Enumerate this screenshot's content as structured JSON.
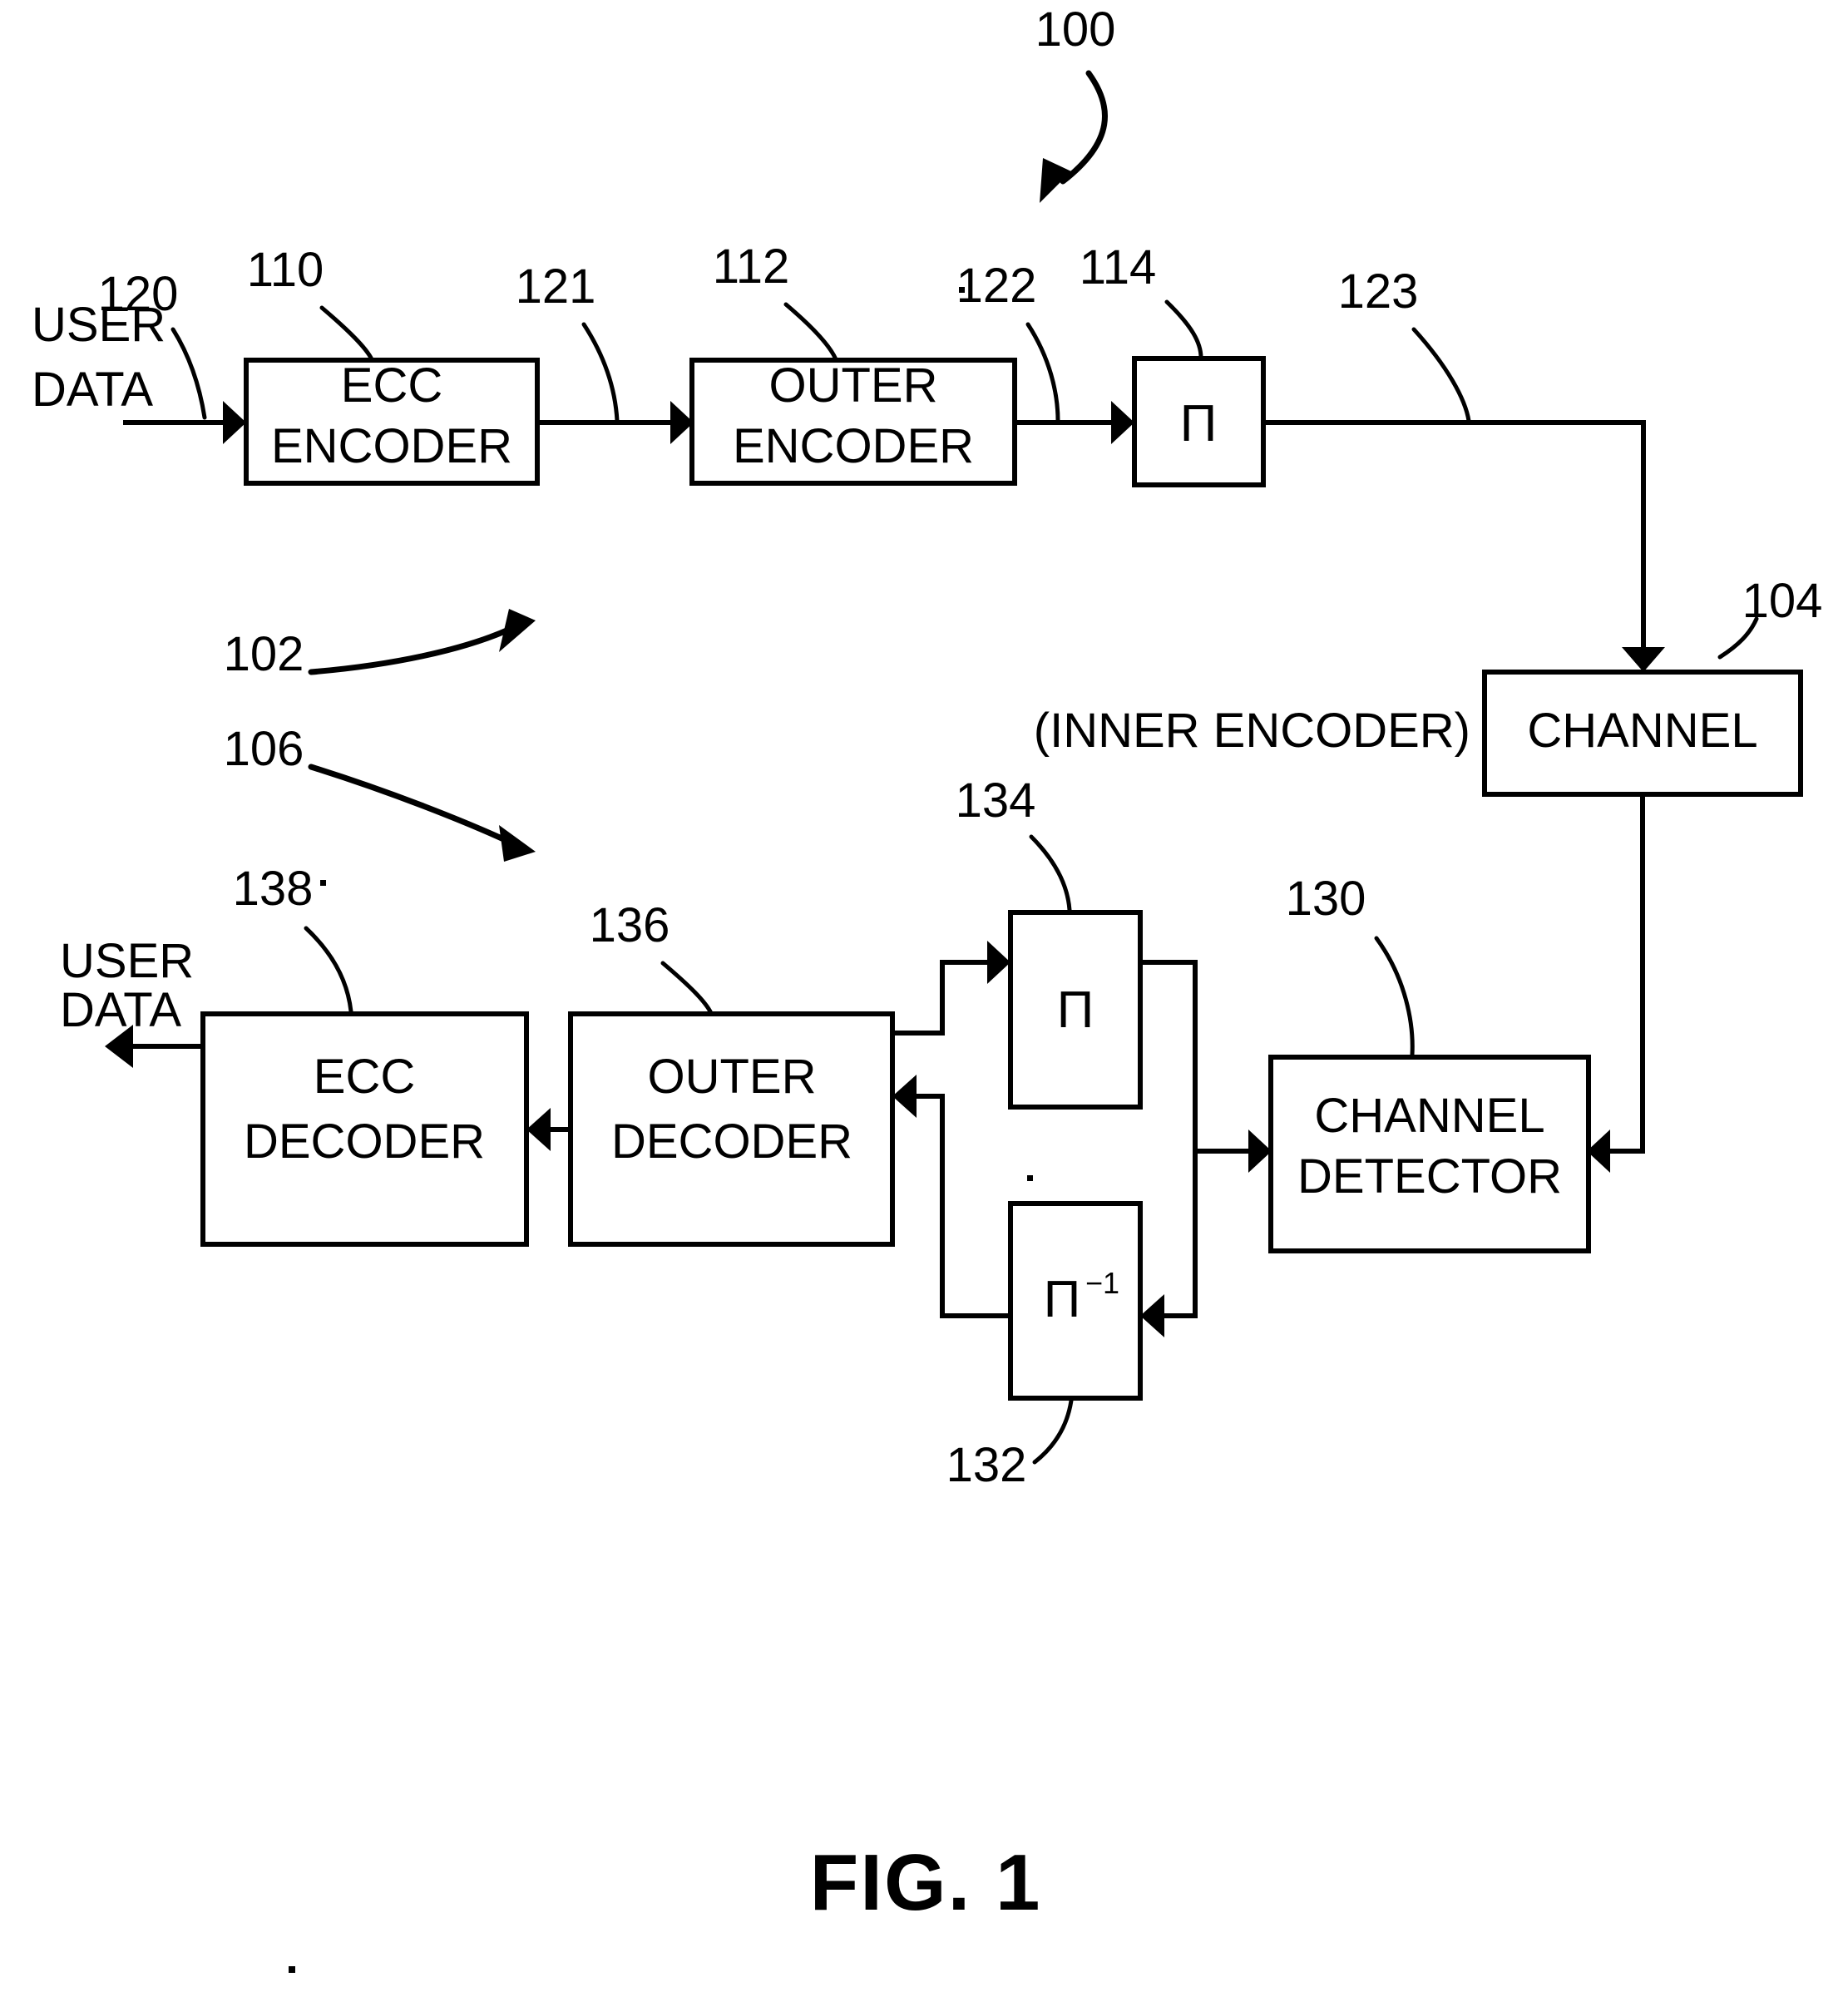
{
  "figure": {
    "caption": "FIG. 1",
    "system_ref": "100",
    "encoder_path_ref": "102",
    "decoder_path_ref": "106"
  },
  "io": {
    "input_line1": "USER",
    "input_line2": "DATA",
    "input_ref": "120",
    "output_line1": "USER",
    "output_line2": "DATA"
  },
  "annotations": {
    "inner_encoder": "(INNER ENCODER)"
  },
  "blocks": [
    {
      "id": "ecc-encoder",
      "ref": "110",
      "line1": "ECC",
      "line2": "ENCODER"
    },
    {
      "id": "outer-encoder",
      "ref": "112",
      "line1": "OUTER",
      "line2": "ENCODER"
    },
    {
      "id": "interleaver-encode",
      "ref": "114",
      "line1": "Π",
      "line2": ""
    },
    {
      "id": "channel",
      "ref": "104",
      "line1": "CHANNEL",
      "line2": ""
    },
    {
      "id": "channel-detector",
      "ref": "130",
      "line1": "CHANNEL",
      "line2": "DETECTOR"
    },
    {
      "id": "interleaver-decode",
      "ref": "134",
      "line1": "Π",
      "line2": ""
    },
    {
      "id": "deinterleaver",
      "ref": "132",
      "line1": "Π",
      "line2": "−1"
    },
    {
      "id": "outer-decoder",
      "ref": "136",
      "line1": "OUTER",
      "line2": "DECODER"
    },
    {
      "id": "ecc-decoder",
      "ref": "138",
      "line1": "ECC",
      "line2": "DECODER"
    }
  ],
  "signals": [
    {
      "id": "sig-121",
      "ref": "121"
    },
    {
      "id": "sig-122",
      "ref": "122"
    },
    {
      "id": "sig-123",
      "ref": "123"
    }
  ],
  "colors": {
    "ink": "#000000",
    "paper": "#ffffff"
  }
}
